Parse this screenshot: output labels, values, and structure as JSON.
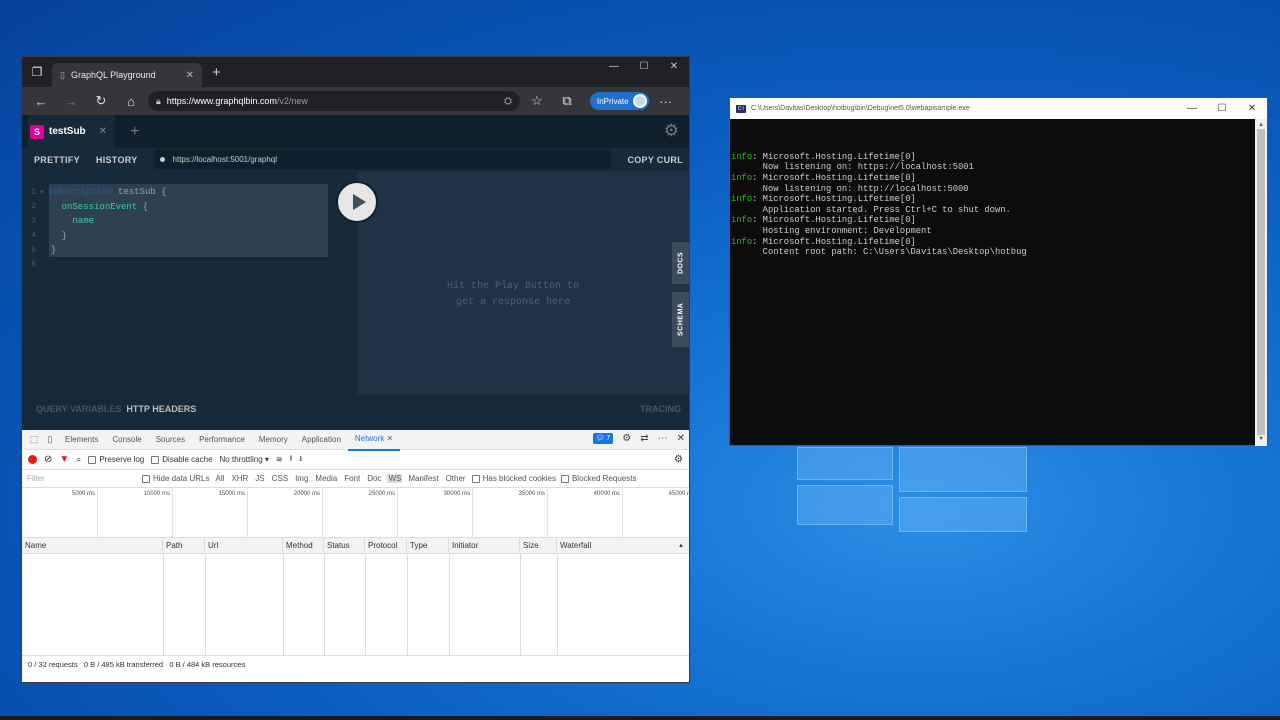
{
  "browser": {
    "tab_title": "GraphQL Playground",
    "url_host": "https://www.graphqlbin.com",
    "url_path": "/v2/new",
    "inprivate_label": "InPrivate"
  },
  "playground": {
    "tab_badge": "S",
    "tab_name": "testSub",
    "toolbar": {
      "prettify": "PRETTIFY",
      "history": "HISTORY",
      "endpoint": "https://localhost:5001/graphql",
      "copy_curl": "COPY CURL"
    },
    "code": {
      "line_numbers": [
        "1",
        "2",
        "3",
        "4",
        "5",
        "6"
      ],
      "kw_subscription": "subscription",
      "op_name": "testSub",
      "field_event": "onSessionEvent",
      "field_name": "name",
      "brace_open": "{",
      "brace_close": "}"
    },
    "result_hint_1": "Hit the Play Button to",
    "result_hint_2": "get a response here",
    "side_docs": "DOCS",
    "side_schema": "SCHEMA",
    "bottom": {
      "query_variables": "QUERY VARIABLES",
      "http_headers": "HTTP HEADERS",
      "tracing": "TRACING"
    }
  },
  "devtools": {
    "tabs": [
      "Elements",
      "Console",
      "Sources",
      "Performance",
      "Memory",
      "Application",
      "Network"
    ],
    "active_tab": "Network",
    "message_count": "7",
    "toolbar": {
      "preserve_log": "Preserve log",
      "disable_cache": "Disable cache",
      "throttling": "No throttling"
    },
    "filter": {
      "placeholder": "Filter",
      "hide_data_urls": "Hide data URLs",
      "types": [
        "All",
        "XHR",
        "JS",
        "CSS",
        "Img",
        "Media",
        "Font",
        "Doc",
        "WS",
        "Manifest",
        "Other"
      ],
      "active_type": "WS",
      "has_blocked_cookies": "Has blocked cookies",
      "blocked_requests": "Blocked Requests"
    },
    "timeline_ticks": [
      "5000 ms",
      "10000 ms",
      "15000 ms",
      "20000 ms",
      "25000 ms",
      "30000 ms",
      "35000 ms",
      "40000 ms",
      "45000 ms"
    ],
    "columns": [
      "Name",
      "Path",
      "Url",
      "Method",
      "Status",
      "Protocol",
      "Type",
      "Initiator",
      "Size",
      "Waterfall"
    ],
    "status": "0 / 32 requests   0 B / 485 kB transferred   0 B / 484 kB resources"
  },
  "console": {
    "title": "C:\\Users\\Davitas\\Desktop\\hotbug\\bin\\Debug\\net5.0\\webapisample.exe",
    "lines": [
      {
        "level": "info",
        "text": ": Microsoft.Hosting.Lifetime[0]"
      },
      {
        "level": "",
        "text": "      Now listening on: https://localhost:5001"
      },
      {
        "level": "info",
        "text": ": Microsoft.Hosting.Lifetime[0]"
      },
      {
        "level": "",
        "text": "      Now listening on: http://localhost:5000"
      },
      {
        "level": "info",
        "text": ": Microsoft.Hosting.Lifetime[0]"
      },
      {
        "level": "",
        "text": "      Application started. Press Ctrl+C to shut down."
      },
      {
        "level": "info",
        "text": ": Microsoft.Hosting.Lifetime[0]"
      },
      {
        "level": "",
        "text": "      Hosting environment: Development"
      },
      {
        "level": "info",
        "text": ": Microsoft.Hosting.Lifetime[0]"
      },
      {
        "level": "",
        "text": "      Content root path: C:\\Users\\Davitas\\Desktop\\hotbug"
      }
    ]
  },
  "colors": {
    "accent": "#1a73e8",
    "playground_bg": "#172a3a",
    "graphql_pink": "#e10098",
    "console_info": "#16c60c"
  }
}
